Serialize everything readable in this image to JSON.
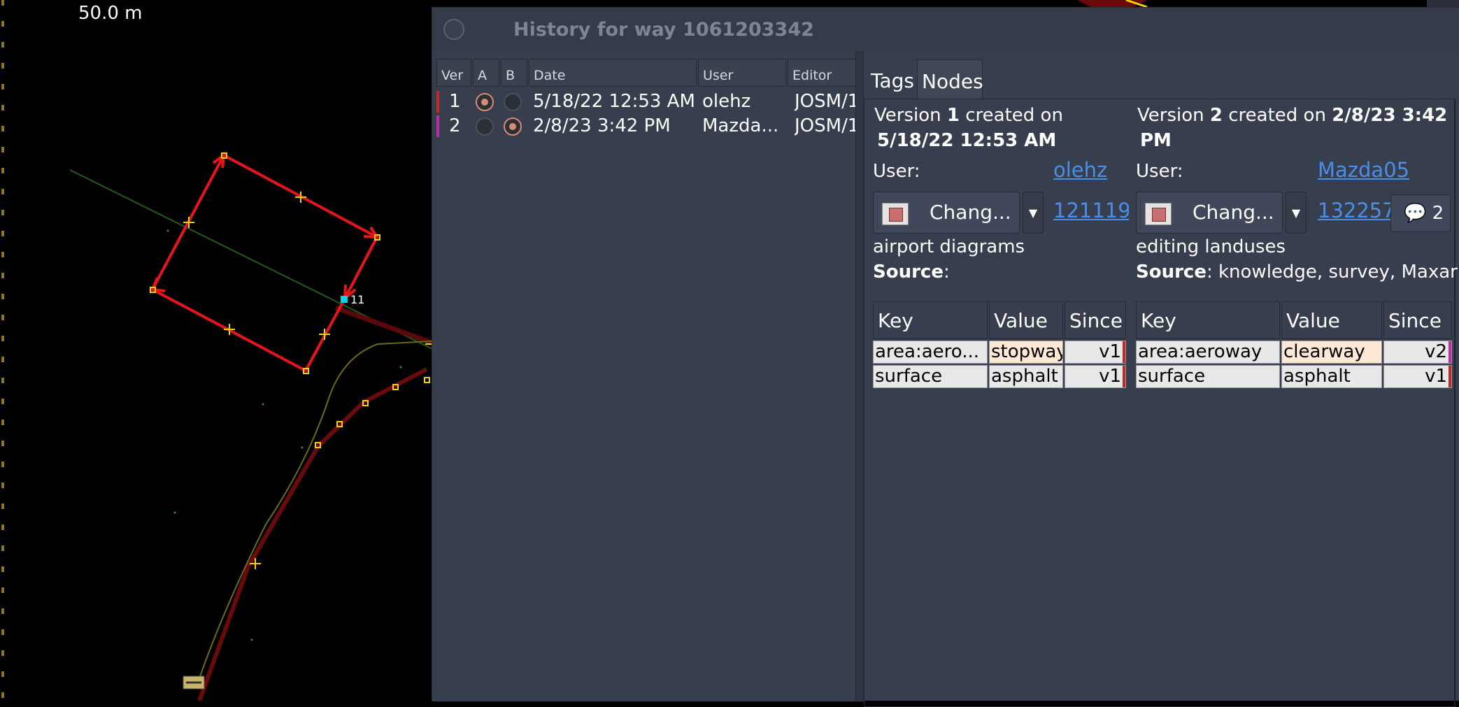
{
  "map": {
    "scale_label": "50.0 m",
    "node_label": "11"
  },
  "dialog": {
    "title": "History for way 1061203342"
  },
  "history_table": {
    "headers": [
      "Ver",
      "A",
      "B",
      "Date",
      "User",
      "Editor"
    ],
    "rows": [
      {
        "ver": "1",
        "a_selected": true,
        "b_selected": false,
        "date": "5/18/22 12:53 AM",
        "user": "olehz",
        "editor": "JOSM/1",
        "color": "#c62828"
      },
      {
        "ver": "2",
        "a_selected": false,
        "b_selected": true,
        "date": "2/8/23 3:42 PM",
        "user": "Mazda...",
        "editor": "JOSM/1",
        "color": "#c02aa8"
      }
    ]
  },
  "tabs": [
    {
      "label": "Tags",
      "active": true
    },
    {
      "label": "Nodes",
      "active": false
    }
  ],
  "left_version": {
    "prefix": "Version",
    "number": "1",
    "created_on": "created on",
    "date": "5/18/22 12:53 AM",
    "user_label": "User:",
    "user_link": "olehz",
    "changeset_button": "Chang...",
    "changeset_link": "121119:",
    "comment": "airport diagrams",
    "source_label": "Source",
    "source_value": ":",
    "tags_headers": [
      "Key",
      "Value",
      "Since"
    ],
    "tags": [
      {
        "key": "area:aero...",
        "value": "stopway",
        "since": "v1",
        "highlight": true,
        "bar_color": "#c62828"
      },
      {
        "key": "surface",
        "value": "asphalt",
        "since": "v1",
        "highlight": false,
        "bar_color": "#c62828"
      }
    ]
  },
  "right_version": {
    "prefix": "Version",
    "number": "2",
    "created_on": "created on",
    "date": "2/8/23 3:42",
    "date_line2": "PM",
    "user_label": "User:",
    "user_link": "Mazda05",
    "changeset_button": "Chang...",
    "changeset_link": "132257:",
    "comment_count": "2",
    "comment": "editing landuses",
    "source_label": "Source",
    "source_value": ": knowledge, survey, Maxar",
    "tags_headers": [
      "Key",
      "Value",
      "Since"
    ],
    "tags": [
      {
        "key": "area:aeroway",
        "value": "clearway",
        "since": "v2",
        "highlight": true,
        "bar_color": "#c02aa8"
      },
      {
        "key": "surface",
        "value": "asphalt",
        "since": "v1",
        "highlight": false,
        "bar_color": "#c62828"
      }
    ]
  },
  "colors": {
    "way_red": "#e8141c",
    "node_yellow": "#f4d400",
    "selected_node": "#00d8e8",
    "dialog_bg": "#373e4d",
    "link_blue": "#4a8ee8"
  }
}
